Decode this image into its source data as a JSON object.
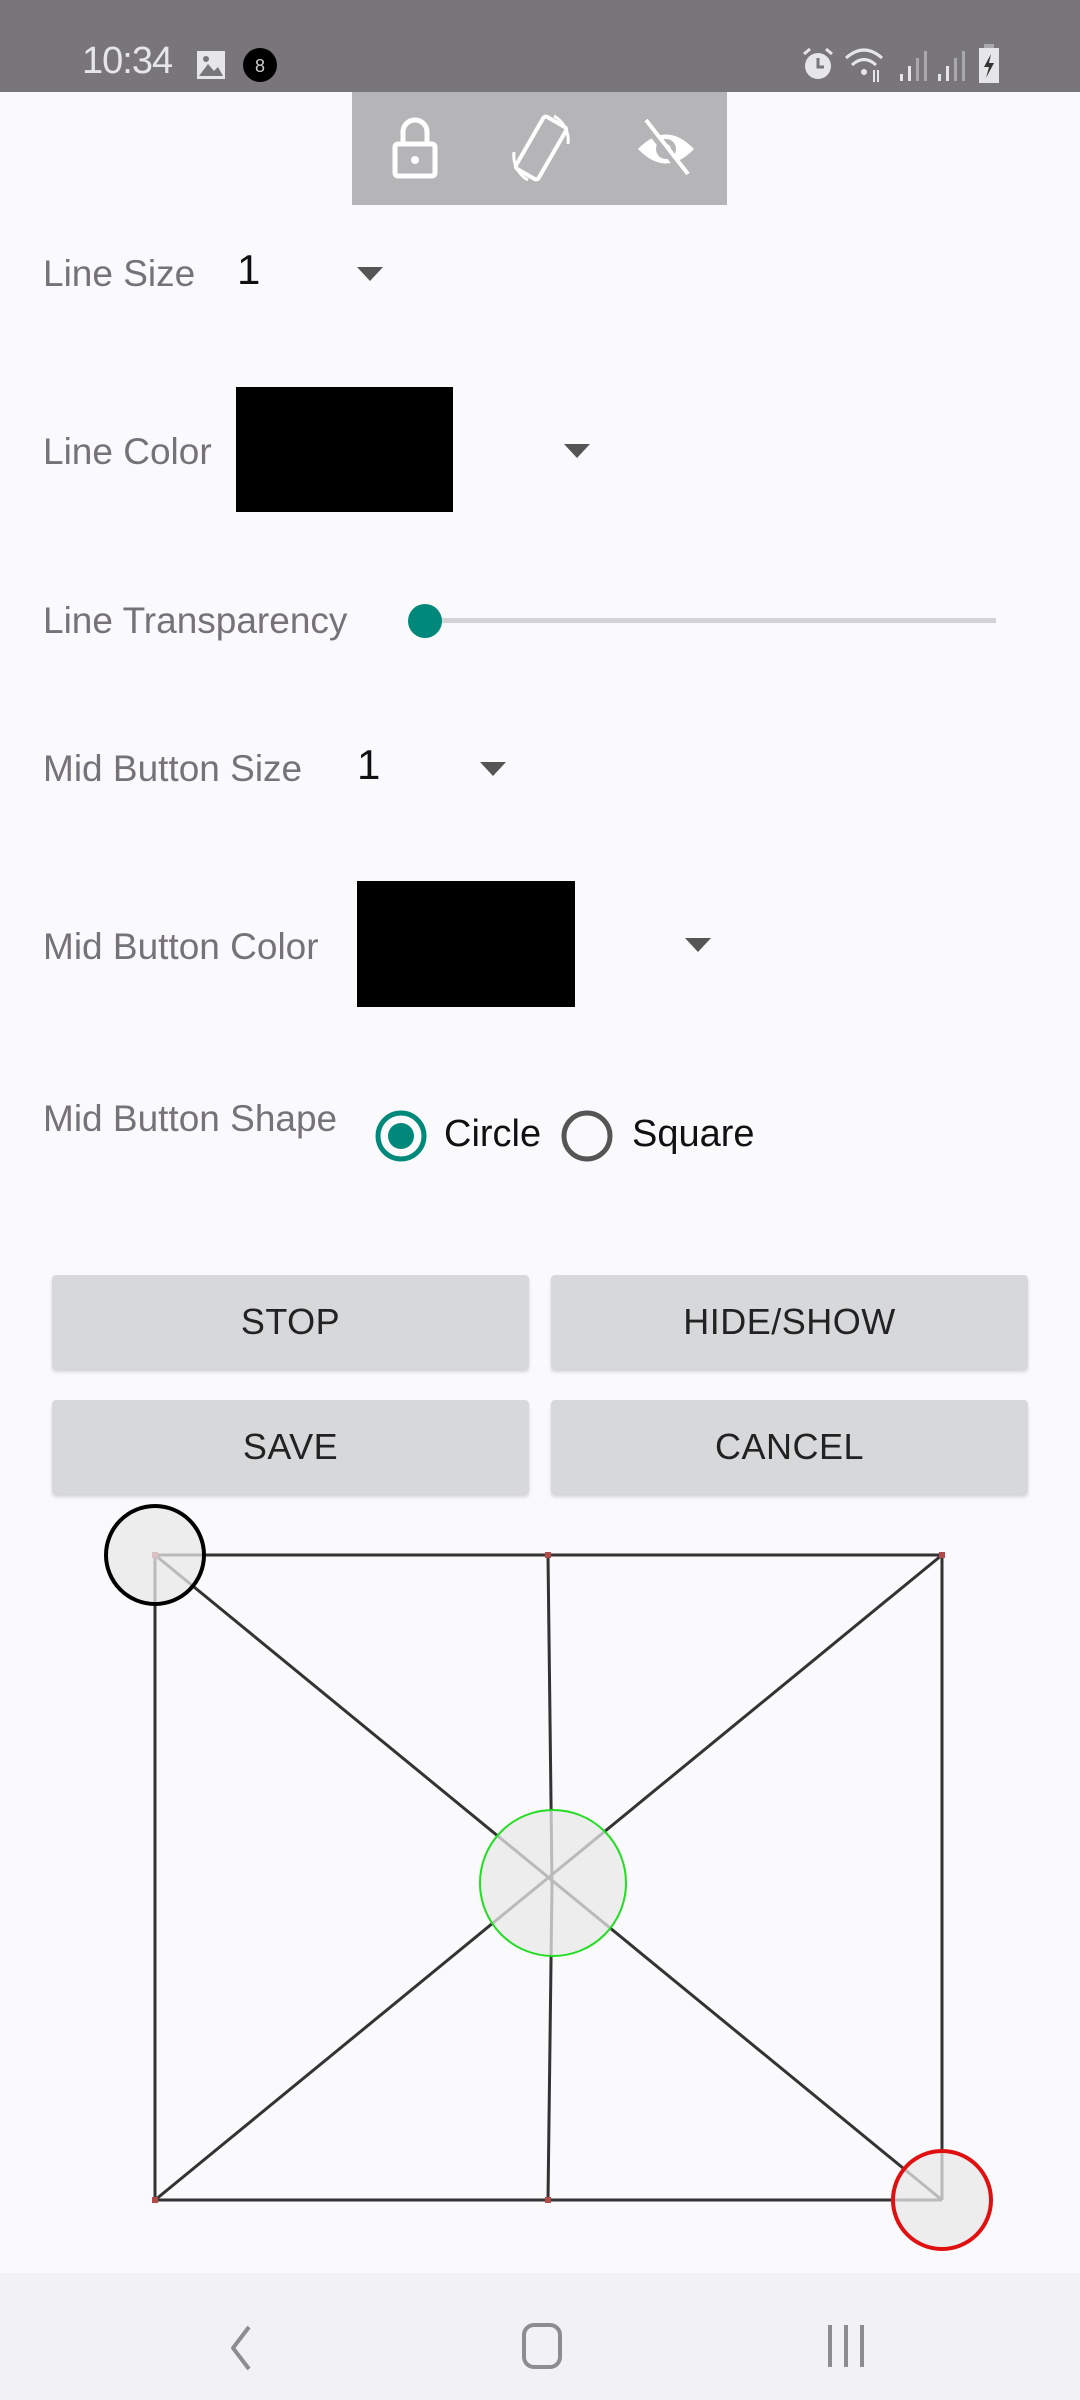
{
  "status_bar": {
    "time": "10:34",
    "left_icons": [
      "gallery-icon",
      "notification-8-icon"
    ],
    "right_icons": [
      "alarm-icon",
      "wifi-icon",
      "signal-icon",
      "signal-icon",
      "battery-charging-icon"
    ]
  },
  "overlay_toolbar": {
    "icons": [
      "lock-icon",
      "screen-rotate-icon",
      "visibility-off-icon"
    ]
  },
  "settings": {
    "line_size": {
      "label": "Line Size",
      "value": "1"
    },
    "line_color": {
      "label": "Line Color",
      "value": "#000000"
    },
    "line_transparency": {
      "label": "Line Transparency",
      "value": 0,
      "accent": "#00897b"
    },
    "mid_button_size": {
      "label": "Mid Button Size",
      "value": "1"
    },
    "mid_button_color": {
      "label": "Mid Button Color",
      "value": "#000000"
    },
    "mid_button_shape": {
      "label": "Mid Button Shape",
      "options": [
        {
          "label": "Circle",
          "selected": true
        },
        {
          "label": "Square",
          "selected": false
        }
      ]
    }
  },
  "buttons": {
    "stop": "STOP",
    "hide_show": "HIDE/SHOW",
    "save": "SAVE",
    "cancel": "CANCEL"
  },
  "canvas": {
    "line_color": "#333333",
    "handles": [
      {
        "name": "top-left-handle",
        "stroke": "#000000"
      },
      {
        "name": "center-handle",
        "stroke": "#22dd22"
      },
      {
        "name": "bottom-right-handle",
        "stroke": "#e01010"
      }
    ]
  },
  "nav_bar": {
    "icons": [
      "back-icon",
      "home-icon",
      "recents-icon"
    ]
  }
}
